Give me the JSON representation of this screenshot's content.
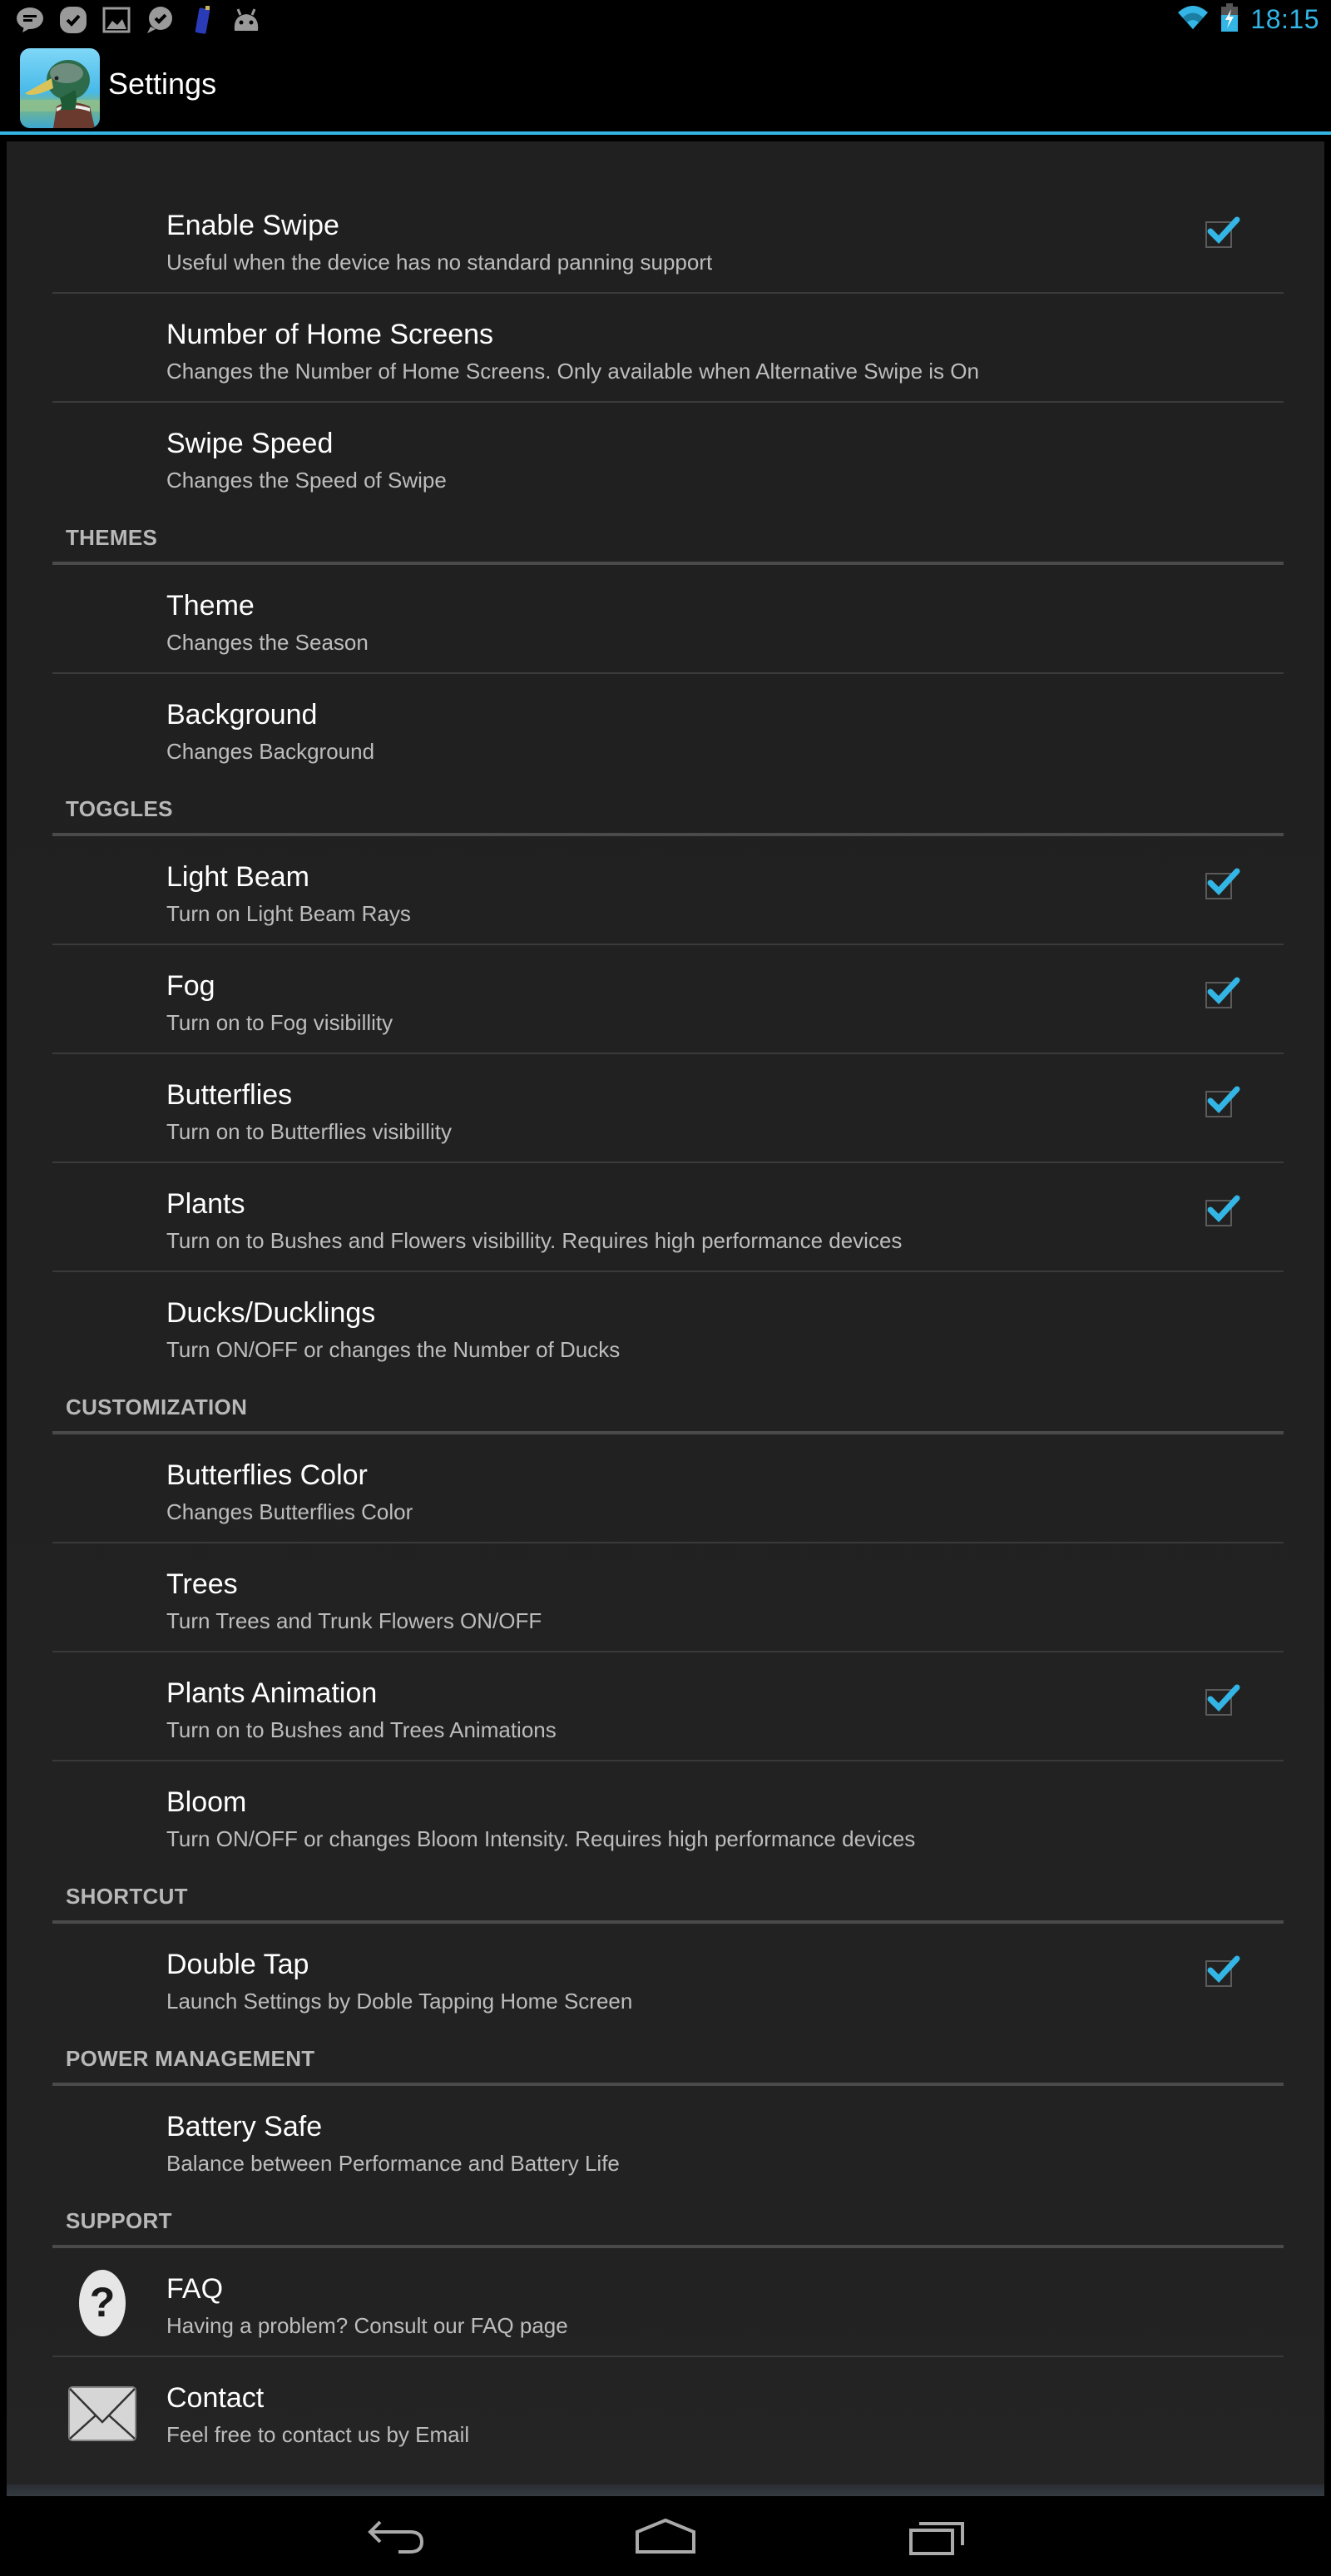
{
  "status_bar": {
    "notification_icons": [
      "message-icon",
      "hangouts-check-icon",
      "gallery-icon",
      "check-bubble-icon",
      "phone-device-icon",
      "android-icon"
    ],
    "wifi": "wifi-icon",
    "battery": "battery-charging-icon",
    "time": "18:15",
    "accent_color": "#33b5e5"
  },
  "action_bar": {
    "app_icon": "duck-app-icon",
    "title": "Settings",
    "accent_color": "#33b5e5"
  },
  "preferences": {
    "general": [
      {
        "title": "Enable Swipe",
        "summary": "Useful when the device has no standard panning support",
        "checkbox": true,
        "checked": true
      },
      {
        "title": "Number of Home Screens",
        "summary": "Changes the Number of Home Screens. Only available when Alternative Swipe is On",
        "checkbox": false
      },
      {
        "title": "Swipe Speed",
        "summary": "Changes the Speed of Swipe",
        "checkbox": false
      }
    ],
    "categories": [
      {
        "label": "THEMES",
        "items": [
          {
            "title": "Theme",
            "summary": "Changes the Season",
            "checkbox": false
          },
          {
            "title": "Background",
            "summary": "Changes Background",
            "checkbox": false
          }
        ]
      },
      {
        "label": "TOGGLES",
        "items": [
          {
            "title": "Light Beam",
            "summary": "Turn on Light Beam Rays",
            "checkbox": true,
            "checked": true
          },
          {
            "title": "Fog",
            "summary": "Turn on to Fog visibillity",
            "checkbox": true,
            "checked": true
          },
          {
            "title": "Butterflies",
            "summary": "Turn on to Butterflies visibillity",
            "checkbox": true,
            "checked": true
          },
          {
            "title": "Plants",
            "summary": "Turn on to Bushes and Flowers visibillity. Requires high performance devices",
            "checkbox": true,
            "checked": true
          },
          {
            "title": "Ducks/Ducklings",
            "summary": "Turn ON/OFF or changes the Number of Ducks",
            "checkbox": false
          }
        ]
      },
      {
        "label": "CUSTOMIZATION",
        "items": [
          {
            "title": "Butterflies Color",
            "summary": "Changes Butterflies Color",
            "checkbox": false
          },
          {
            "title": "Trees",
            "summary": "Turn Trees and Trunk Flowers ON/OFF",
            "checkbox": false
          },
          {
            "title": "Plants Animation",
            "summary": "Turn on to Bushes and Trees Animations",
            "checkbox": true,
            "checked": true
          },
          {
            "title": "Bloom",
            "summary": "Turn ON/OFF or changes Bloom Intensity. Requires high performance devices",
            "checkbox": false
          }
        ]
      },
      {
        "label": "SHORTCUT",
        "items": [
          {
            "title": "Double Tap",
            "summary": "Launch Settings by Doble Tapping Home Screen",
            "checkbox": true,
            "checked": true
          }
        ]
      },
      {
        "label": "POWER MANAGEMENT",
        "items": [
          {
            "title": "Battery Safe",
            "summary": "Balance between Performance and Battery Life",
            "checkbox": false
          }
        ]
      },
      {
        "label": "SUPPORT",
        "items": [
          {
            "title": "FAQ",
            "summary": "Having a problem? Consult our FAQ page",
            "checkbox": false,
            "icon": "help-question-icon"
          },
          {
            "title": "Contact",
            "summary": "Feel free to contact us by Email",
            "checkbox": false,
            "icon": "email-envelope-icon"
          }
        ]
      }
    ]
  },
  "nav_bar": {
    "buttons": [
      "back-icon",
      "home-icon",
      "recent-apps-icon"
    ]
  }
}
